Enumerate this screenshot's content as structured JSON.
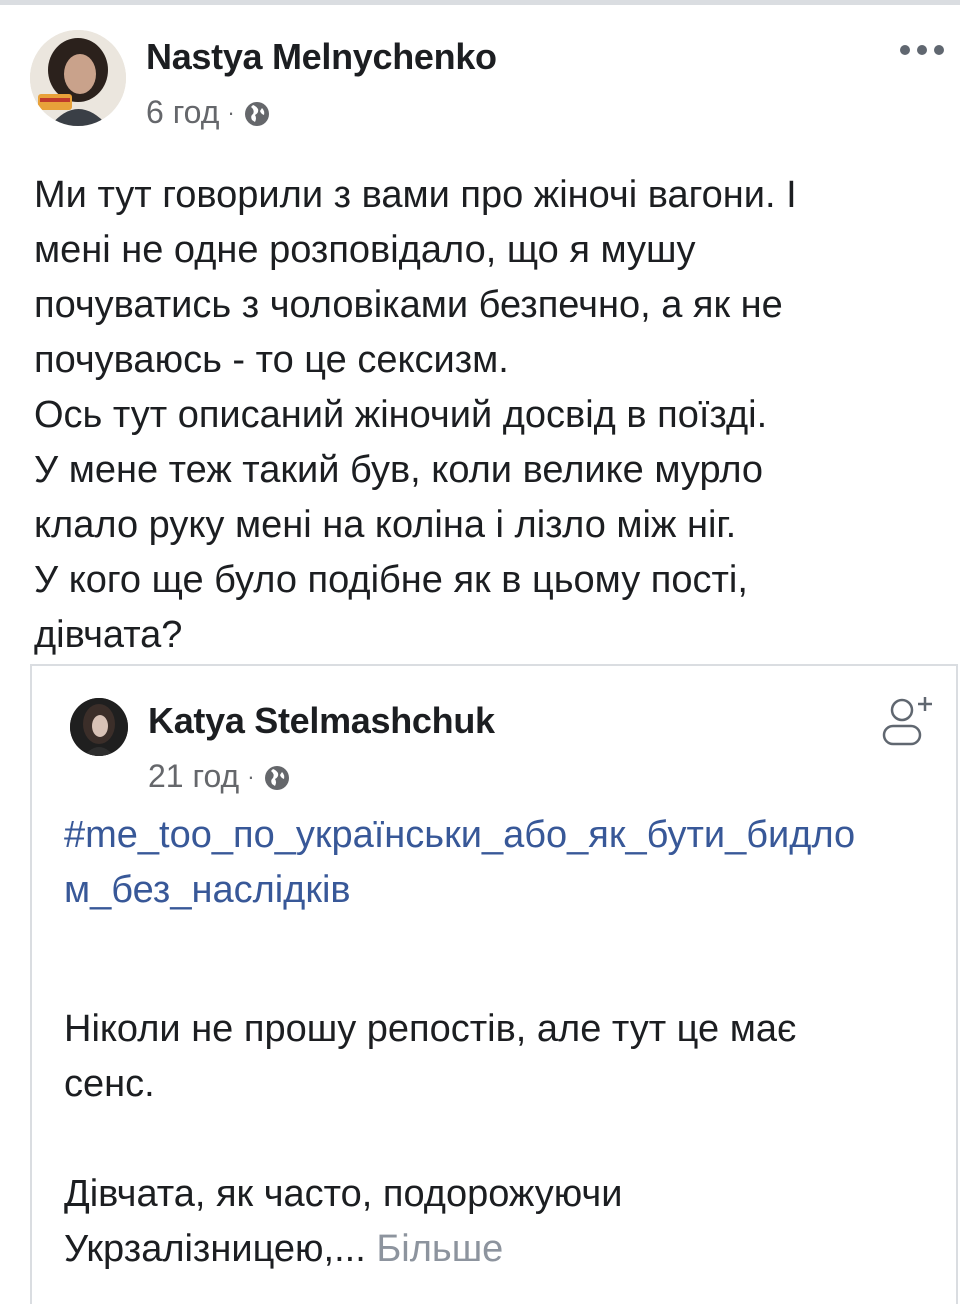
{
  "post": {
    "author": "Nastya Melnychenko",
    "time": "6 год",
    "separator": "·",
    "privacy_icon": "globe-icon",
    "more_icon": "more-options-icon",
    "text_lines": [
      "Ми тут говорили з вами про жіночі вагони. І",
      "мені не одне розповідало, що я мушу",
      "почуватись з чоловіками безпечно, а як не",
      "почуваюсь - то це сексизм.",
      "Ось тут описаний жіночий досвід в поїзді.",
      "У мене теж такий був, коли велике мурло",
      "клало руку мені на коліна і лізло між ніг.",
      "У кого ще було подібне як в цьому пості,",
      "дівчата?"
    ]
  },
  "shared_post": {
    "author": "Katya Stelmashchuk",
    "time": "21 год",
    "separator": "·",
    "privacy_icon": "globe-icon",
    "add_friend_icon": "add-friend-icon",
    "hashtag_line_1": "#me_too_по_українськи_або_як_бути_бидло",
    "hashtag_line_2": "м_без_наслідків",
    "paragraph_1_line_1": "Ніколи не прошу репостів, але тут це має",
    "paragraph_1_line_2": "сенс.",
    "paragraph_2_line_1": "Дівчата, як часто, подорожуючи",
    "paragraph_2_line_2": "Укрзалізницею,...",
    "see_more": "Більше"
  },
  "colors": {
    "link": "#385898",
    "secondary_text": "#65676b",
    "see_more": "#8d949e",
    "border": "#dadde1"
  }
}
